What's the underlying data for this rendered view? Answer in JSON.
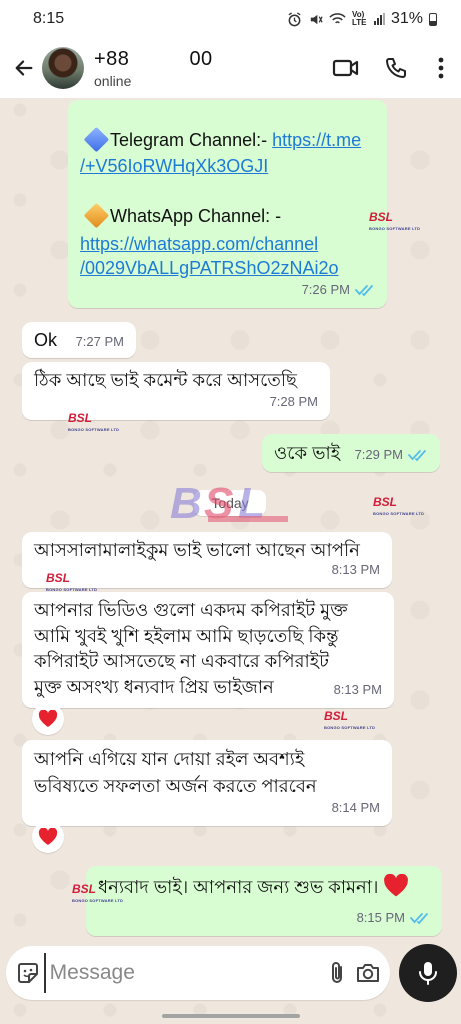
{
  "status_bar": {
    "time": "8:15",
    "network": "Vo) LTE",
    "battery": "31%"
  },
  "header": {
    "contact_name": "+88",
    "contact_name_tail": "00",
    "contact_status": "online"
  },
  "messages": [
    {
      "direction": "out",
      "telegram_label": "Telegram Channel:- ",
      "telegram_link_1": "https://t.me",
      "telegram_link_2": "/+V56IoRWHqXk3OGJI",
      "whatsapp_label": "WhatsApp Channel: -",
      "whatsapp_link_1": "https://whatsapp.com/channel",
      "whatsapp_link_2": "/0029VbALLgPATRShO2zNAi2o",
      "time": "7:26 PM"
    },
    {
      "direction": "in",
      "text": "Ok",
      "time": "7:27 PM"
    },
    {
      "direction": "in",
      "text": "ঠিক আছে ভাই কমেন্ট করে আসতেছি",
      "time": "7:28 PM"
    },
    {
      "direction": "out",
      "text": "ওকে ভাই",
      "time": "7:29 PM"
    },
    {
      "direction": "in",
      "text": "আসসালামালাইকুম ভাই ভালো আছেন আপনি",
      "time": "8:13 PM"
    },
    {
      "direction": "in",
      "lines": [
        "আপনার ভিডিও গুলো একদম কপিরাইট মুক্ত",
        "আমি খুবই খুশি হইলাম আমি ছাড়তেছি কিন্তু",
        "কপিরাইট আসতেছে না একবারে কপিরাইট",
        "মুক্ত অসংখ্য ধন্যবাদ প্রিয় ভাইজান"
      ],
      "time": "8:13 PM",
      "reaction": "heart"
    },
    {
      "direction": "in",
      "lines": [
        "আপনি এগিয়ে যান দোয়া রইল অবশ্যই",
        "ভবিষ্যতে সফলতা  অর্জন করতে পারবেন"
      ],
      "time": "8:14 PM",
      "reaction": "heart"
    },
    {
      "direction": "out",
      "text": "ধন্যবাদ ভাই। আপনার জন্য শুভ কামনা।",
      "time": "8:15 PM"
    }
  ],
  "date_divider": "Today",
  "watermark": {
    "logo_text": "BSL",
    "sub_text": "BONGO SOFTWARE LTD"
  },
  "input": {
    "placeholder": "Message"
  },
  "colors": {
    "incoming_bubble": "#ffffff",
    "outgoing_bubble": "#d9fdd3",
    "read_ticks": "#53bdeb",
    "link": "#1d7bd6",
    "heart": "#e5222e"
  }
}
